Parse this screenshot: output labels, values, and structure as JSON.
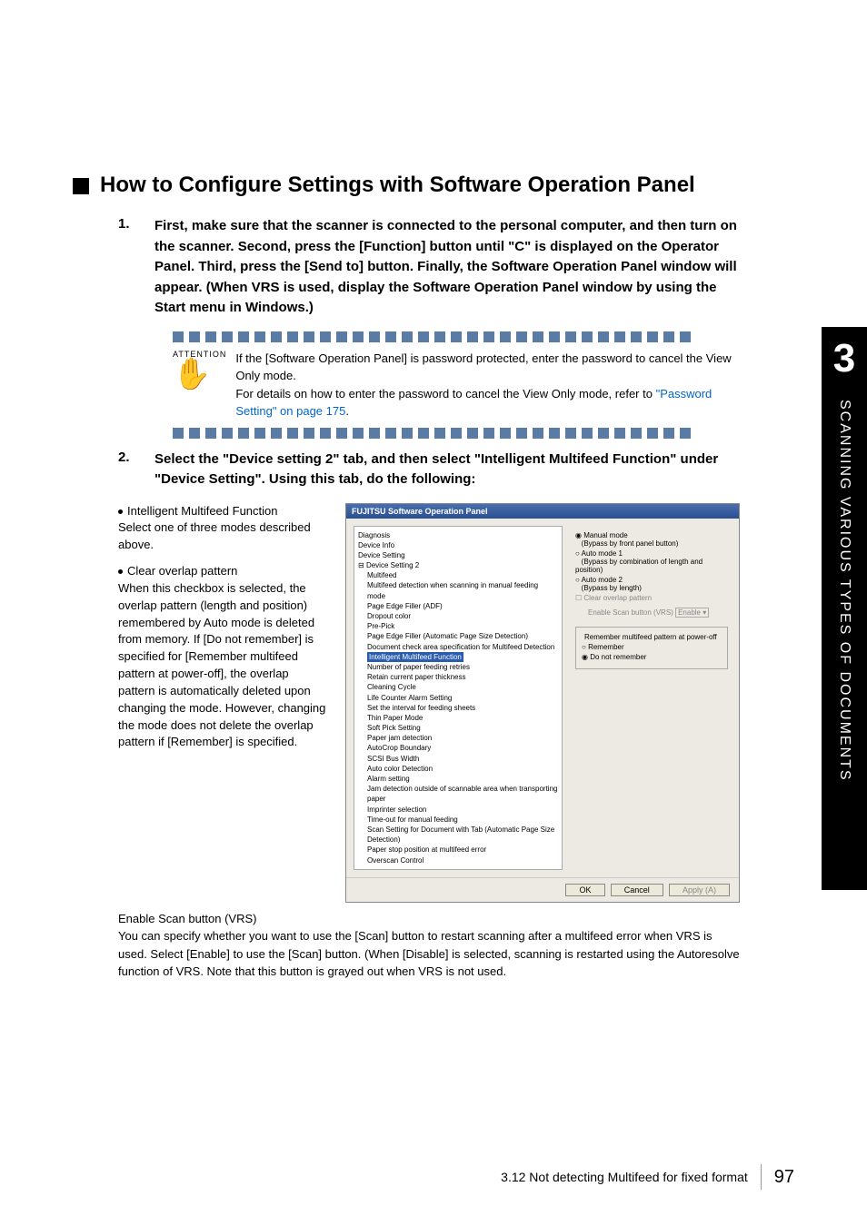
{
  "sidebar": {
    "chapter": "3",
    "text": "SCANNING VARIOUS TYPES OF DOCUMENTS"
  },
  "heading": "How to Configure Settings with Software Operation Panel",
  "step1": {
    "num": "1.",
    "text": "First, make sure that the scanner is connected to the personal computer, and then turn on the scanner. Second, press the [Function] button until \"C\" is displayed on the Operator Panel. Third, press the [Send to] button. Finally, the Software Operation Panel window will appear. (When VRS is used, display the Software Operation Panel window by using the Start menu in Windows.)"
  },
  "attention": {
    "label": "ATTENTION",
    "line1": "If the [Software Operation Panel] is password protected, enter the password to cancel the View Only mode.",
    "line2": "For details on how to enter the password to cancel the View Only mode, refer to ",
    "link": "\"Password Setting\" on page 175",
    "tail": "."
  },
  "step2": {
    "num": "2.",
    "text": "Select the \"Device setting 2\" tab, and then select \"Intelligent Multifeed Function\" under \"Device Setting\". Using this tab, do the following:"
  },
  "bullets": {
    "b1": {
      "h": "Intelligent Multifeed Function",
      "t": "Select one of three modes described above."
    },
    "b2": {
      "h": "Clear overlap pattern",
      "t": "When this checkbox is selected, the overlap pattern (length and position) remembered by Auto mode is deleted from memory. If [Do not remember] is specified for [Remember multifeed pattern at power-off], the overlap pattern is automatically deleted upon changing the mode. However, changing the mode does not delete the overlap pattern if [Remember] is specified."
    },
    "b3": {
      "h": "Enable Scan button (VRS)",
      "t": "You can specify whether you want to use the [Scan] button to restart scanning after a multifeed error when VRS is used.  Select [Enable] to use the [Scan] button. (When [Disable] is selected, scanning is restarted using the Autoresolve function of VRS. Note that this button is grayed out when VRS is not used."
    }
  },
  "sop": {
    "title": "FUJITSU Software Operation Panel",
    "tree": [
      "Diagnosis",
      "Device Info",
      "Device Setting",
      "Device Setting 2",
      "Multifeed",
      "Multifeed detection when scanning in manual feeding mode",
      "Page Edge Filler (ADF)",
      "Dropout color",
      "Pre-Pick",
      "Page Edge Filler (Automatic Page Size Detection)",
      "Document check area specification for Multifeed Detection",
      "Intelligent Multifeed Function",
      "Number of paper feeding retries",
      "Retain current paper thickness",
      "Cleaning Cycle",
      "Life Counter Alarm Setting",
      "Set the interval for feeding sheets",
      "Thin Paper Mode",
      "Soft Pick Setting",
      "Paper jam detection",
      "AutoCrop Boundary",
      "SCSI Bus Width",
      "Auto color Detection",
      "Alarm setting",
      "Jam detection outside of scannable area when transporting paper",
      "Imprinter selection",
      "Time-out for manual feeding",
      "Scan Setting for Document with Tab (Automatic Page Size Detection)",
      "Paper stop position at multifeed error",
      "Overscan Control"
    ],
    "radios": {
      "r1": "Manual mode",
      "r1s": "(Bypass by front panel button)",
      "r2": "Auto mode 1",
      "r2s": "(Bypass by combination of length and position)",
      "r3": "Auto mode 2",
      "r3s": "(Bypass by length)"
    },
    "clear": "Clear overlap pattern",
    "enable": "Enable Scan button (VRS)",
    "dropdown": "Enable",
    "legend": "Remember multifeed pattern at power-off",
    "remember": "Remember",
    "donot": "Do not remember",
    "ok": "OK",
    "cancel": "Cancel",
    "apply": "Apply (A)"
  },
  "footer": {
    "section": "3.12 Not detecting Multifeed for fixed format",
    "page": "97"
  }
}
